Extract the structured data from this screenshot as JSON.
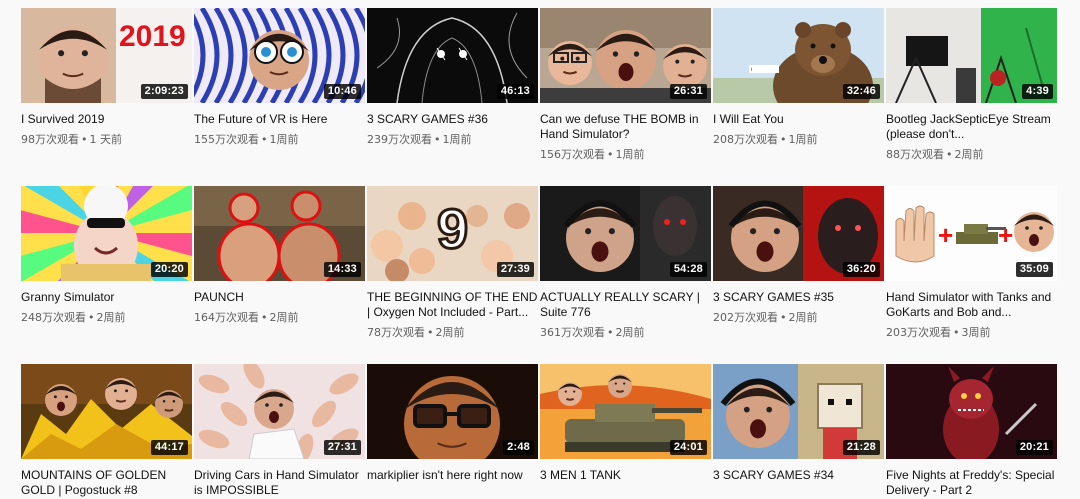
{
  "rows": [
    [
      {
        "title": "I Survived 2019",
        "duration": "2:09:23",
        "views": "98万次观看",
        "age": "1 天前",
        "thumb": "thumb-2019-icon"
      },
      {
        "title": "The Future of VR is Here",
        "duration": "10:46",
        "views": "155万次观看",
        "age": "1周前",
        "thumb": "thumb-vr-icon"
      },
      {
        "title": "3 SCARY GAMES #36",
        "duration": "46:13",
        "views": "239万次观看",
        "age": "1周前",
        "thumb": "thumb-dark-sketch-icon"
      },
      {
        "title": "Can we defuse THE BOMB in Hand Simulator?",
        "duration": "26:31",
        "views": "156万次观看",
        "age": "1周前",
        "thumb": "thumb-three-faces-icon"
      },
      {
        "title": "I Will Eat You",
        "duration": "32:46",
        "views": "208万次观看",
        "age": "1周前",
        "thumb": "thumb-bear-icon"
      },
      {
        "title": "Bootleg JackSepticEye Stream (please don't...",
        "duration": "4:39",
        "views": "88万次观看",
        "age": "2周前",
        "thumb": "thumb-studio-icon"
      }
    ],
    [
      {
        "title": "Granny Simulator",
        "duration": "20:20",
        "views": "248万次观看",
        "age": "2周前",
        "thumb": "thumb-granny-icon"
      },
      {
        "title": "PAUNCH",
        "duration": "14:33",
        "views": "164万次观看",
        "age": "2周前",
        "thumb": "thumb-paunch-icon"
      },
      {
        "title": "THE BEGINNING OF THE END | Oxygen Not Included - Part...",
        "duration": "27:39",
        "views": "78万次观看",
        "age": "2周前",
        "thumb": "thumb-oxygen-icon"
      },
      {
        "title": "ACTUALLY REALLY SCARY | Suite 776",
        "duration": "54:28",
        "views": "361万次观看",
        "age": "2周前",
        "thumb": "thumb-scream-icon"
      },
      {
        "title": "3 SCARY GAMES #35",
        "duration": "36:20",
        "views": "202万次观看",
        "age": "2周前",
        "thumb": "thumb-red-scare-icon"
      },
      {
        "title": "Hand Simulator with Tanks and GoKarts and Bob and...",
        "duration": "35:09",
        "views": "203万次观看",
        "age": "3周前",
        "thumb": "thumb-hand-tank-icon"
      }
    ],
    [
      {
        "title": "MOUNTAINS OF GOLDEN GOLD | Pogostuck #8",
        "duration": "44:17",
        "views": "",
        "age": "",
        "thumb": "thumb-gold-icon"
      },
      {
        "title": "Driving Cars in Hand Simulator is IMPOSSIBLE",
        "duration": "27:31",
        "views": "",
        "age": "",
        "thumb": "thumb-hands-icon"
      },
      {
        "title": "markiplier isn't here right now",
        "duration": "2:48",
        "views": "",
        "age": "",
        "thumb": "thumb-glasses-icon"
      },
      {
        "title": "3 MEN 1 TANK",
        "duration": "24:01",
        "views": "",
        "age": "",
        "thumb": "thumb-tank-icon"
      },
      {
        "title": "3 SCARY GAMES #34",
        "duration": "21:28",
        "views": "",
        "age": "",
        "thumb": "thumb-roblox-icon"
      },
      {
        "title": "Five Nights at Freddy's: Special Delivery - Part 2",
        "duration": "20:21",
        "views": "",
        "age": "",
        "thumb": "thumb-fnaf-icon"
      }
    ]
  ],
  "meta_separator": "•"
}
